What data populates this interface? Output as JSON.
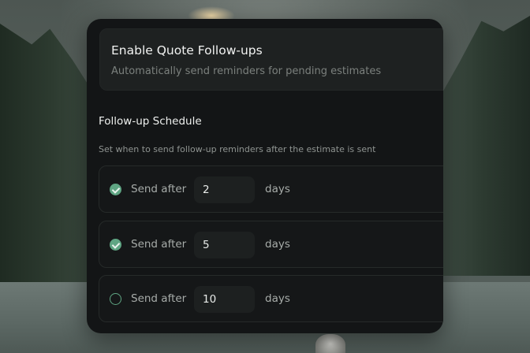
{
  "toggle": {
    "title": "Enable Quote Follow-ups",
    "description": "Automatically send reminders for pending estimates"
  },
  "schedule": {
    "title": "Follow-up Schedule",
    "description": "Set when to send follow-up reminders after the estimate is sent",
    "rows": [
      {
        "enabled": true,
        "label": "Send after",
        "value": "2",
        "unit": "days"
      },
      {
        "enabled": true,
        "label": "Send after",
        "value": "5",
        "unit": "days"
      },
      {
        "enabled": false,
        "label": "Send after",
        "value": "10",
        "unit": "days"
      }
    ]
  },
  "colors": {
    "accent": "#5fa583",
    "panel": "#131516",
    "card": "#1e2121"
  }
}
